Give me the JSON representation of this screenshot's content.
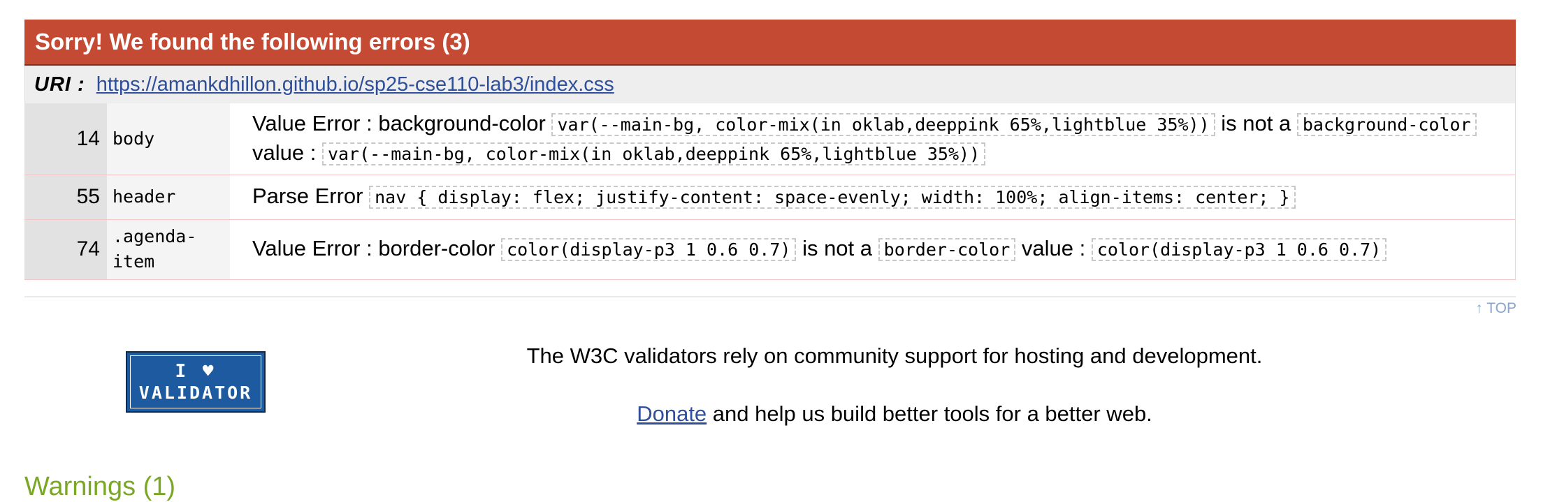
{
  "errors_section": {
    "title": "Sorry! We found the following errors (3)",
    "uri_label": "URI :",
    "uri": "https://amankdhillon.github.io/sp25-cse110-lab3/index.css",
    "rows": [
      {
        "line": "14",
        "selector": "body",
        "segments": [
          {
            "type": "text",
            "value": "Value Error : background-color "
          },
          {
            "type": "code",
            "value": "var(--main-bg, color-mix(in oklab,deeppink 65%,lightblue 35%))"
          },
          {
            "type": "text",
            "value": " is not a "
          },
          {
            "type": "code",
            "value": "background-color"
          },
          {
            "type": "text",
            "value": " value : "
          },
          {
            "type": "code",
            "value": "var(--main-bg, color-mix(in oklab,deeppink 65%,lightblue 35%))"
          }
        ]
      },
      {
        "line": "55",
        "selector": "header",
        "segments": [
          {
            "type": "text",
            "value": "Parse Error "
          },
          {
            "type": "code",
            "value": "nav { display: flex; justify-content: space-evenly; width: 100%; align-items: center; }"
          }
        ]
      },
      {
        "line": "74",
        "selector": ".agenda-item",
        "segments": [
          {
            "type": "text",
            "value": "Value Error : border-color "
          },
          {
            "type": "code",
            "value": "color(display-p3 1 0.6 0.7)"
          },
          {
            "type": "text",
            "value": " is not a "
          },
          {
            "type": "code",
            "value": "border-color"
          },
          {
            "type": "text",
            "value": " value : "
          },
          {
            "type": "code",
            "value": "color(display-p3 1 0.6 0.7)"
          }
        ]
      }
    ]
  },
  "top_link": "↑ TOP",
  "badge": {
    "line1": "I ♥",
    "line2": "VALIDATOR"
  },
  "support": {
    "line1": "The W3C validators rely on community support for hosting and development.",
    "donate_label": "Donate",
    "line2_rest": " and help us build better tools for a better web."
  },
  "warnings_heading": "Warnings (1)",
  "colors": {
    "error_header_bg": "#c44a33",
    "link": "#2f4f9a",
    "warnings": "#7aa824"
  }
}
